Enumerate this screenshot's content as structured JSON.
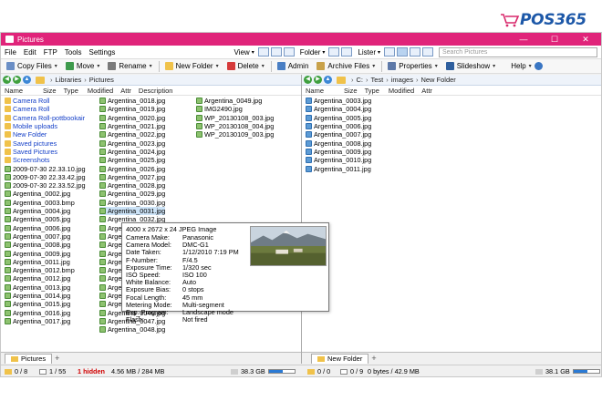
{
  "brand": {
    "logo_text": "POS365"
  },
  "window": {
    "title": "Pictures",
    "controls": [
      "—",
      "☐",
      "✕"
    ]
  },
  "menu": {
    "items": [
      "File",
      "Edit",
      "FTP",
      "Tools",
      "Settings"
    ],
    "view_label": "View",
    "folder_label": "Folder",
    "lister_label": "Lister",
    "search_placeholder": "Search Pictures"
  },
  "toolbar": {
    "buttons": [
      {
        "label": "Copy Files",
        "icon": "copy-icon"
      },
      {
        "label": "Move",
        "icon": "move-icon"
      },
      {
        "label": "Rename",
        "icon": "rename-icon"
      },
      {
        "label": "New Folder",
        "icon": "new-folder-icon"
      },
      {
        "label": "Delete",
        "icon": "delete-icon"
      },
      {
        "label": "Admin",
        "icon": "admin-icon"
      },
      {
        "label": "Archive Files",
        "icon": "archive-icon"
      },
      {
        "label": "Properties",
        "icon": "properties-icon"
      },
      {
        "label": "Slideshow",
        "icon": "slideshow-icon"
      },
      {
        "label": "Help",
        "icon": "help-icon"
      }
    ]
  },
  "left_pane": {
    "breadcrumb": [
      "Libraries",
      "Pictures"
    ],
    "columns": [
      "Name",
      "Size",
      "Type",
      "Modified",
      "Attr",
      "Description"
    ],
    "col1": [
      {
        "name": "Camera Roll",
        "kind": "folder"
      },
      {
        "name": "Camera Roll",
        "kind": "folder"
      },
      {
        "name": "Camera Roll-pottbookair",
        "kind": "folder"
      },
      {
        "name": "Mobile uploads",
        "kind": "folder"
      },
      {
        "name": "New Folder",
        "kind": "folder"
      },
      {
        "name": "Saved pictures",
        "kind": "folder"
      },
      {
        "name": "Saved Pictures",
        "kind": "folder"
      },
      {
        "name": "Screenshots",
        "kind": "folder"
      },
      {
        "name": "2009-07-30 22.33.10.jpg",
        "kind": "img"
      },
      {
        "name": "2009-07-30 22.33.42.jpg",
        "kind": "img"
      },
      {
        "name": "2009-07-30 22.33.52.jpg",
        "kind": "img"
      },
      {
        "name": "Argentina_0002.jpg",
        "kind": "img"
      },
      {
        "name": "Argentina_0003.bmp",
        "kind": "img"
      },
      {
        "name": "Argentina_0004.jpg",
        "kind": "img"
      },
      {
        "name": "Argentina_0005.jpg",
        "kind": "img"
      },
      {
        "name": "Argentina_0006.jpg",
        "kind": "img"
      },
      {
        "name": "Argentina_0007.jpg",
        "kind": "img"
      },
      {
        "name": "Argentina_0008.jpg",
        "kind": "img"
      },
      {
        "name": "Argentina_0009.jpg",
        "kind": "img"
      },
      {
        "name": "Argentina_0011.jpg",
        "kind": "img"
      },
      {
        "name": "Argentina_0012.bmp",
        "kind": "img"
      },
      {
        "name": "Argentina_0012.jpg",
        "kind": "img"
      },
      {
        "name": "Argentina_0013.jpg",
        "kind": "img"
      },
      {
        "name": "Argentina_0014.jpg",
        "kind": "img"
      },
      {
        "name": "Argentina_0015.jpg",
        "kind": "img"
      },
      {
        "name": "Argentina_0016.jpg",
        "kind": "img"
      },
      {
        "name": "Argentina_0017.jpg",
        "kind": "img"
      }
    ],
    "col2": [
      "Argentina_0018.jpg",
      "Argentina_0019.jpg",
      "Argentina_0020.jpg",
      "Argentina_0021.jpg",
      "Argentina_0022.jpg",
      "Argentina_0023.jpg",
      "Argentina_0024.jpg",
      "Argentina_0025.jpg",
      "Argentina_0026.jpg",
      "Argentina_0027.jpg",
      "Argentina_0028.jpg",
      "Argentina_0029.jpg",
      "Argentina_0030.jpg",
      "Argentina_0031.jpg",
      "Argentina_0032.jpg",
      "Arge",
      "Arge",
      "Arge",
      "Arge",
      "Arge",
      "Arge",
      "Arge",
      "Arge",
      "Arge",
      "Argentina_0045.jpg",
      "Argentina_0046.jpg",
      "Argentina_0047.jpg",
      "Argentina_0048.jpg"
    ],
    "col3": [
      "Argentina_0049.jpg",
      "IMG2490.jpg",
      "WP_20130108_003.jpg",
      "WP_20130108_004.jpg",
      "WP_20130109_003.jpg"
    ],
    "selected_index_col2": 13,
    "tab_label": "Pictures"
  },
  "right_pane": {
    "breadcrumb": [
      "C:",
      "Test",
      "images",
      "New Folder"
    ],
    "columns": [
      "Name",
      "Size",
      "Type",
      "Modified",
      "Attr"
    ],
    "files": [
      "Argentina_0003.jpg",
      "Argentina_0004.jpg",
      "Argentina_0005.jpg",
      "Argentina_0006.jpg",
      "Argentina_0007.jpg",
      "Argentina_0008.jpg",
      "Argentina_0009.jpg",
      "Argentina_0010.jpg",
      "Argentina_0011.jpg"
    ],
    "tab_label": "New Folder"
  },
  "tooltip": {
    "header": "4000 x 2672 x 24 JPEG Image",
    "rows": [
      {
        "k": "Camera Make:",
        "v": "Panasonic"
      },
      {
        "k": "Camera Model:",
        "v": "DMC-G1"
      },
      {
        "k": "Date Taken:",
        "v": "1/12/2010 7:19 PM"
      },
      {
        "k": "F-Number:",
        "v": "F/4.5"
      },
      {
        "k": "Exposure Time:",
        "v": "1/320 sec"
      },
      {
        "k": "ISO Speed:",
        "v": "ISO 100"
      },
      {
        "k": "White Balance:",
        "v": "Auto"
      },
      {
        "k": "Exposure Bias:",
        "v": "0 stops"
      },
      {
        "k": "Focal Length:",
        "v": "45 mm"
      },
      {
        "k": "Metering Mode:",
        "v": "Multi-segment"
      },
      {
        "k": "Exp. Program:",
        "v": "Landscape mode"
      },
      {
        "k": "Flash:",
        "v": "Not fired"
      }
    ]
  },
  "status": {
    "left_folders": "0 / 8",
    "left_files": "1 / 55",
    "hidden": "1 hidden",
    "left_size": "4.56 MB / 284 MB",
    "left_free": "38.3 GB",
    "left_free_fraction": 0.55,
    "right_folders": "0 / 0",
    "right_files": "0 / 9",
    "right_size": "0 bytes / 42.9 MB",
    "right_free": "38.1 GB",
    "right_free_fraction": 0.55
  },
  "colors": {
    "titlebar": "#e0247a",
    "folder_text": "#1540c8",
    "hidden_text": "#d00000",
    "logo": "#1d58a8"
  }
}
